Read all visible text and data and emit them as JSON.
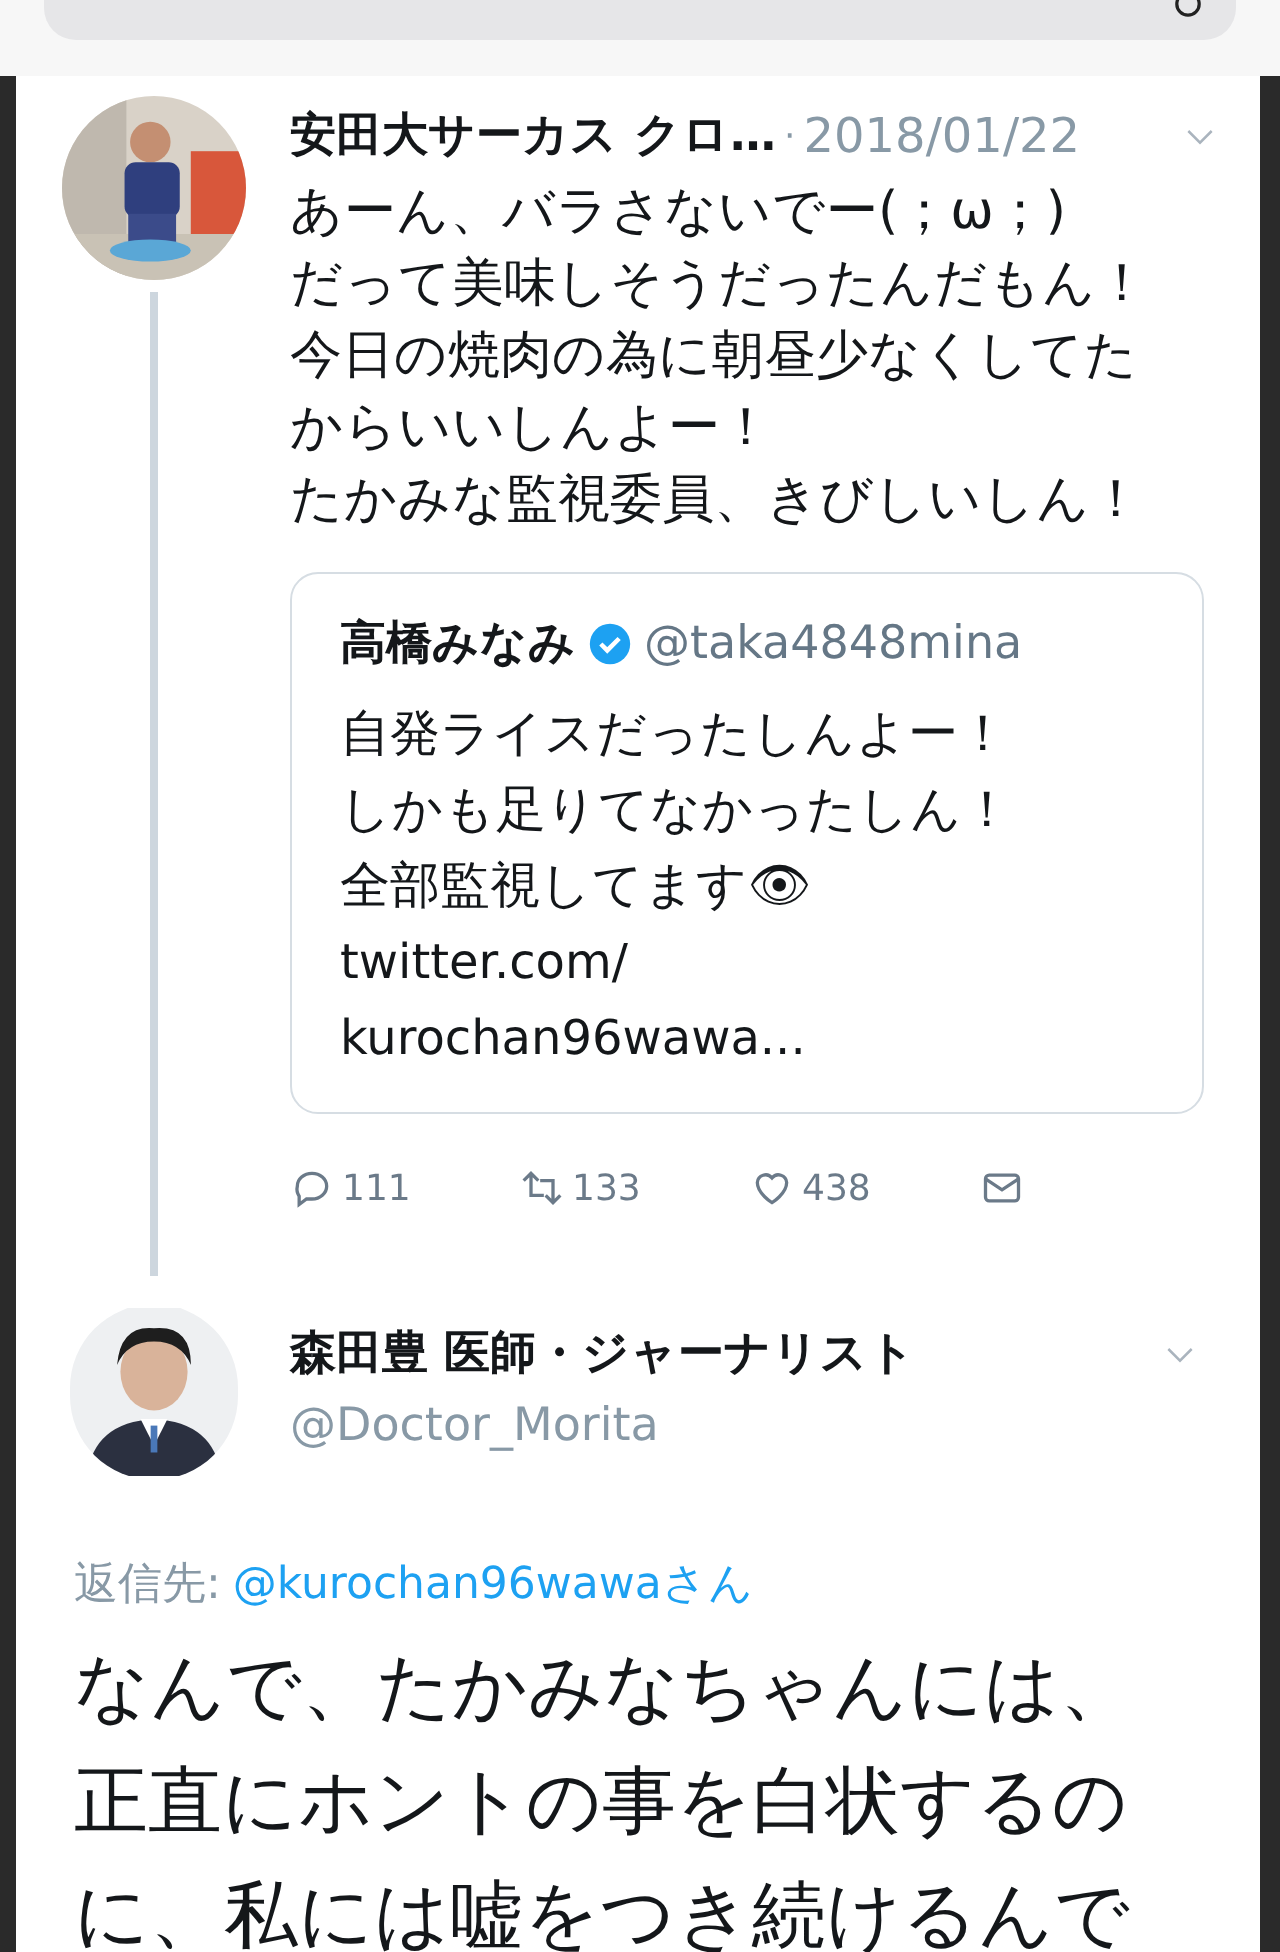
{
  "tweets": [
    {
      "author": "安田大サーカス クロ…",
      "separator": "·",
      "date": "2018/01/22",
      "lines": [
        "あーん、バラさないでー(；ω；)",
        "だって美味しそうだったんだもん！",
        "今日の焼肉の為に朝昼少なくしてた",
        "からいいしんよー！",
        "たかみな監視委員、きびしいしん！"
      ],
      "quote": {
        "author": "高橋みなみ",
        "verified": true,
        "handle": "@taka4848mina",
        "lines": [
          "自発ライスだったしんよー！",
          "しかも足りてなかったしん！",
          "全部監視してます👁"
        ],
        "link_lines": [
          "twitter.com/",
          "kurochan96wawa..."
        ]
      },
      "actions": [
        {
          "kind": "reply",
          "count": "111"
        },
        {
          "kind": "retweet",
          "count": "133"
        },
        {
          "kind": "like",
          "count": "438"
        },
        {
          "kind": "message"
        }
      ]
    },
    {
      "author": "森田豊 医師・ジャーナリスト",
      "handle": "@Doctor_Morita",
      "reply_to": {
        "label": "返信先:",
        "user": "@kurochan96wawa",
        "suffix": "さん"
      },
      "lines": [
        "なんで、たかみなちゃんには、",
        "正直にホントの事を白状するの",
        "に、私には嘘をつき続けるんで"
      ]
    }
  ]
}
